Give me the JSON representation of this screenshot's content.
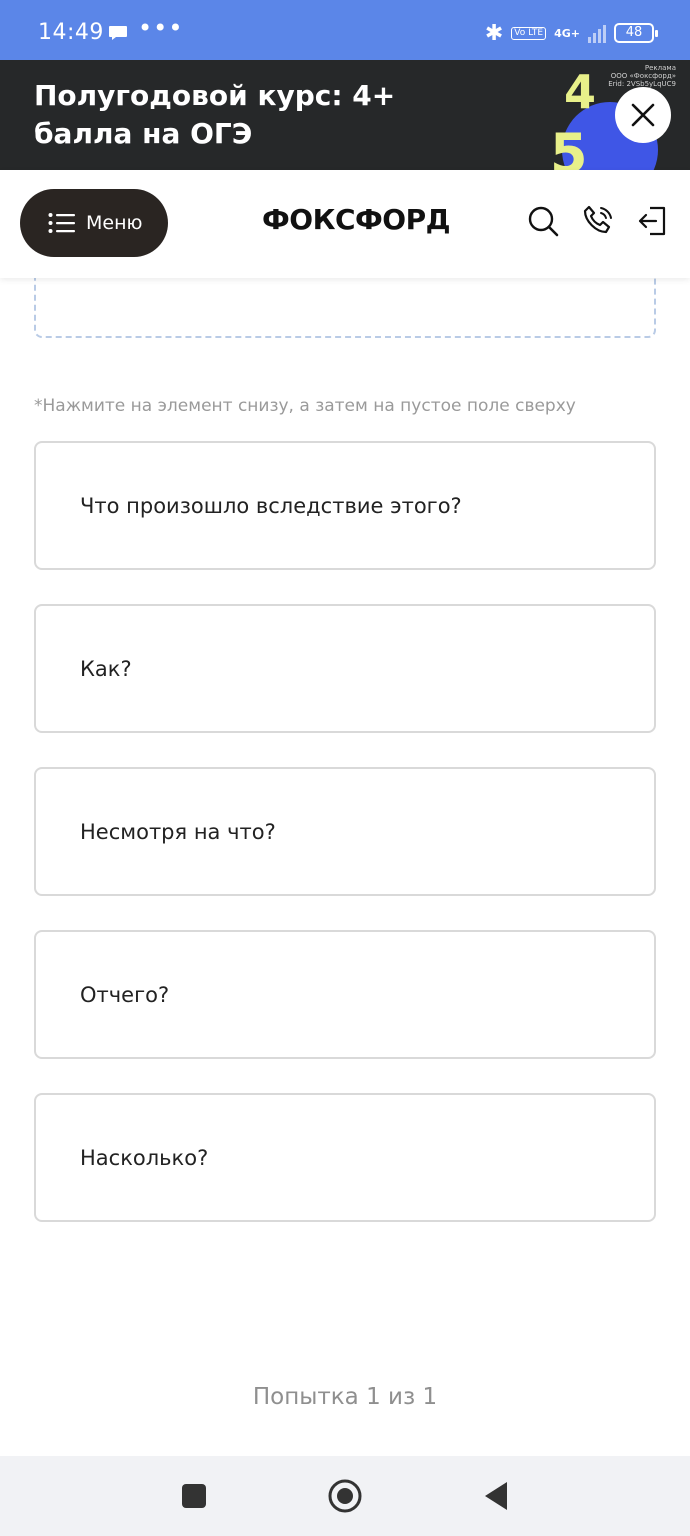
{
  "status_bar": {
    "time": "14:49",
    "dots": "•••",
    "volte": "Vo LTE",
    "network": "4G+",
    "battery": "48"
  },
  "ad": {
    "title": "Полугодовой курс: 4+ балла на ОГЭ",
    "label_line1": "Реклама",
    "label_line2": "ООО «Фоксфорд»",
    "label_line3": "Erid: 2VSb5yLqUC9",
    "art_digit_top": "4",
    "art_digit_bottom": "5"
  },
  "header": {
    "menu_label": "Меню",
    "logo_text": "ФОКСФОРД"
  },
  "task": {
    "hint": "*Нажмите на элемент снизу, а затем на пустое поле сверху",
    "options": [
      "Что произошло вследствие этого?",
      "Как?",
      "Несмотря на что?",
      "Отчего?",
      "Насколько?"
    ],
    "attempt": "Попытка 1 из 1"
  },
  "colors": {
    "status_bar": "#5b86e8",
    "ad_bg": "#262829",
    "menu_button": "#2a2522",
    "dropzone_border": "#b9cbe6",
    "option_border": "#d9d9d9",
    "accent_purple": "#7b4ddb"
  }
}
